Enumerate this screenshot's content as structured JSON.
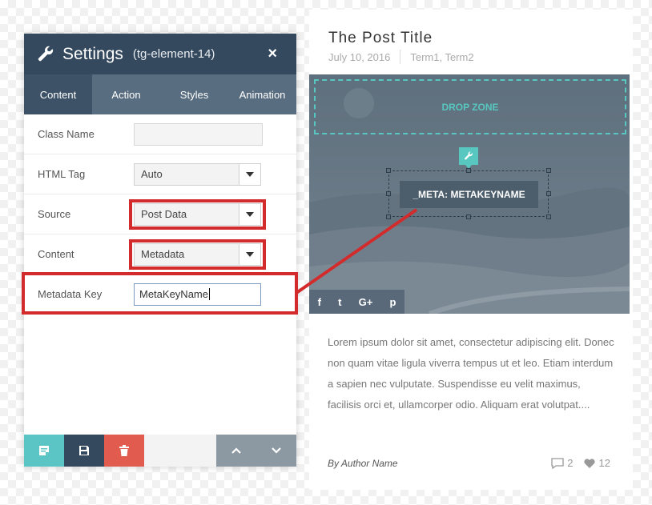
{
  "panel": {
    "title": "Settings",
    "subtitle": "(tg-element-14)",
    "close_label": "×",
    "tabs": [
      {
        "label": "Content"
      },
      {
        "label": "Action"
      },
      {
        "label": "Styles"
      },
      {
        "label": "Animation"
      }
    ],
    "rows": {
      "class_name": {
        "label": "Class Name",
        "value": ""
      },
      "html_tag": {
        "label": "HTML Tag",
        "value": "Auto"
      },
      "source": {
        "label": "Source",
        "value": "Post Data"
      },
      "content": {
        "label": "Content",
        "value": "Metadata"
      },
      "metadata_key": {
        "label": "Metadata Key",
        "value": "MetaKeyName"
      }
    }
  },
  "preview": {
    "title": "The Post Title",
    "date": "July 10, 2016",
    "terms": "Term1, Term2",
    "drop_zone": "DROP ZONE",
    "meta_element": "_META: METAKEYNAME",
    "social": [
      "f",
      "t",
      "G+",
      "p"
    ],
    "excerpt": "Lorem ipsum dolor sit amet, consectetur adipiscing elit. Donec non quam vitae ligula viverra tempus ut et leo. Etiam interdum a sapien nec vulputate. Suspendisse eu velit maximus, facilisis orci et, ullamcorper odio. Aliquam erat volutpat....",
    "author": "By Author Name",
    "comments": "2",
    "likes": "12"
  },
  "colors": {
    "header": "#34495e",
    "tabs": "#596d80",
    "accent": "#5bc5c5",
    "highlight": "#d32b2b"
  }
}
